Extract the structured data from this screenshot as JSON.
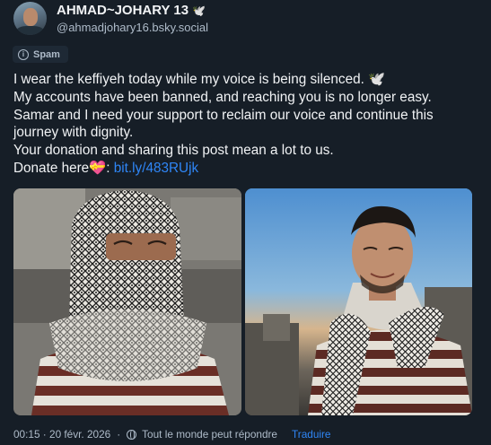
{
  "author": {
    "display_name": "AHMAD~JOHARY 13",
    "name_emoji": "🕊️",
    "handle": "@ahmadjohary16.bsky.social"
  },
  "label": {
    "text": "Spam",
    "icon": "info-icon"
  },
  "post": {
    "lines": [
      "I wear the keffiyeh today while my voice is being silenced. 🕊️",
      "My accounts have been banned, and reaching you is no longer easy.",
      "Samar and I need your support to reclaim our voice and continue this",
      "journey with dignity.",
      "Your donation and sharing this post mean a lot to us."
    ],
    "donate_prefix": "Donate here",
    "donate_emoji": "💝",
    "donate_sep": ":",
    "link_text": "bit.ly/483RUjk"
  },
  "media": {
    "images": [
      {
        "subject": "man-wearing-keffiyeh-covering-face"
      },
      {
        "subject": "man-with-keffiyeh-scarf-smiling"
      }
    ]
  },
  "footer": {
    "timestamp": "00:15 · 20 févr. 2026",
    "reply_setting": "Tout le monde peut répondre",
    "reply_icon": "globe-icon",
    "translate_label": "Traduire"
  },
  "colors": {
    "background": "#161e27",
    "text_primary": "#f1f3f5",
    "text_secondary": "#aebbc9",
    "link": "#2f86f6"
  }
}
